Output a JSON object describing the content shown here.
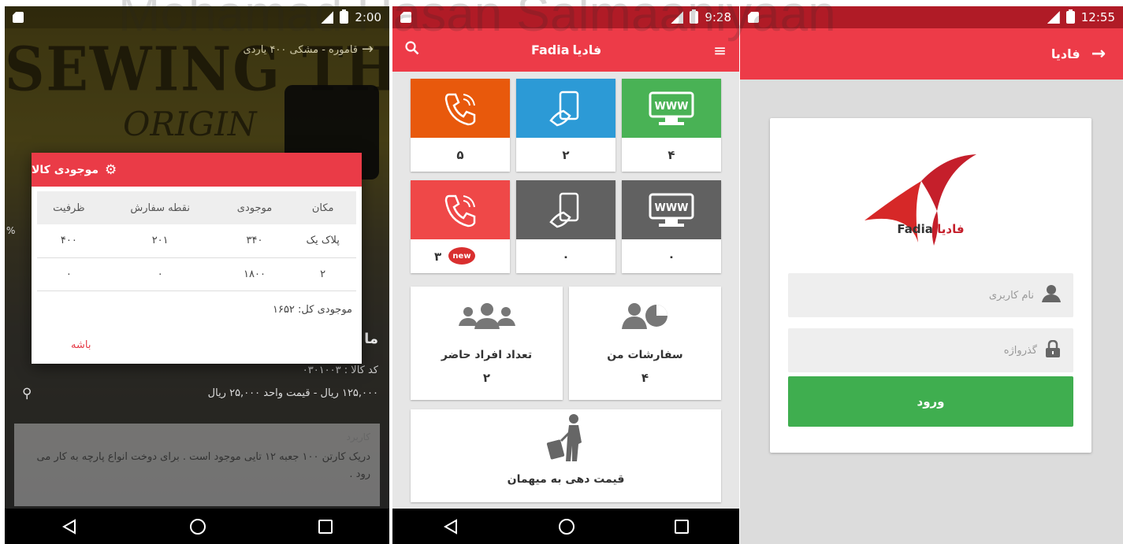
{
  "panel1": {
    "status_time": "2:00",
    "top_text": "قاموره - مشکی ۴۰۰ یاردی",
    "dialog_title": "موجودی کالا",
    "columns": [
      "مکان",
      "موجودی",
      "نقطه سفارش",
      "ظرفیت"
    ],
    "rows": [
      [
        "پلاک یک",
        "۳۴۰",
        "۲۰۱",
        "۴۰۰"
      ],
      [
        "۲",
        "۱۸۰۰",
        "۰",
        "۰"
      ]
    ],
    "total": "موجودی کل: ۱۶۵۲",
    "ok_label": "باشه",
    "pct": "%",
    "behind_title": "ما",
    "code_text": "کد کالا : ۰۳۰۱۰۰۳",
    "price_text": "۱۲۵,۰۰۰ ریال - قیمت واحد ۲۵,۰۰۰ ریال",
    "usage_title": "کاربرد",
    "usage_body": "دریک کارتن ۱۰۰ جعبه ۱۲ تایی موجود است . برای دوخت انواع پارچه به کار می رود ."
  },
  "panel2": {
    "status_time": "9:28",
    "brand_en": "Fadia",
    "brand_fa": "فادیا",
    "tiles": [
      {
        "value": "۴",
        "icon": "www-icon",
        "color": "#49b255"
      },
      {
        "value": "۲",
        "icon": "mobile-icon",
        "color": "#2c9ad6"
      },
      {
        "value": "۵",
        "icon": "phone-icon",
        "color": "#e8590c"
      },
      {
        "value": "۰",
        "icon": "www-icon",
        "color": "#616161"
      },
      {
        "value": "۰",
        "icon": "mobile-icon",
        "color": "#616161"
      },
      {
        "value": "۳",
        "icon": "phone-icon",
        "color": "#ef4848"
      }
    ],
    "new_badge": "new",
    "cards": [
      {
        "label": "سفارشات من",
        "value": "۴"
      },
      {
        "label": "تعداد افراد حاضر",
        "value": "۲"
      },
      {
        "label": "قیمت دهی به میهمان",
        "value": ""
      }
    ]
  },
  "panel3": {
    "status_time": "12:55",
    "title": "فادیا",
    "logo_en": "Fadia",
    "logo_fa": "فادیا",
    "username_placeholder": "نام کاربری",
    "password_placeholder": "گذرواژه",
    "login_label": "ورود"
  },
  "watermark": "Mohamad Hasan Salmaaniyaan"
}
